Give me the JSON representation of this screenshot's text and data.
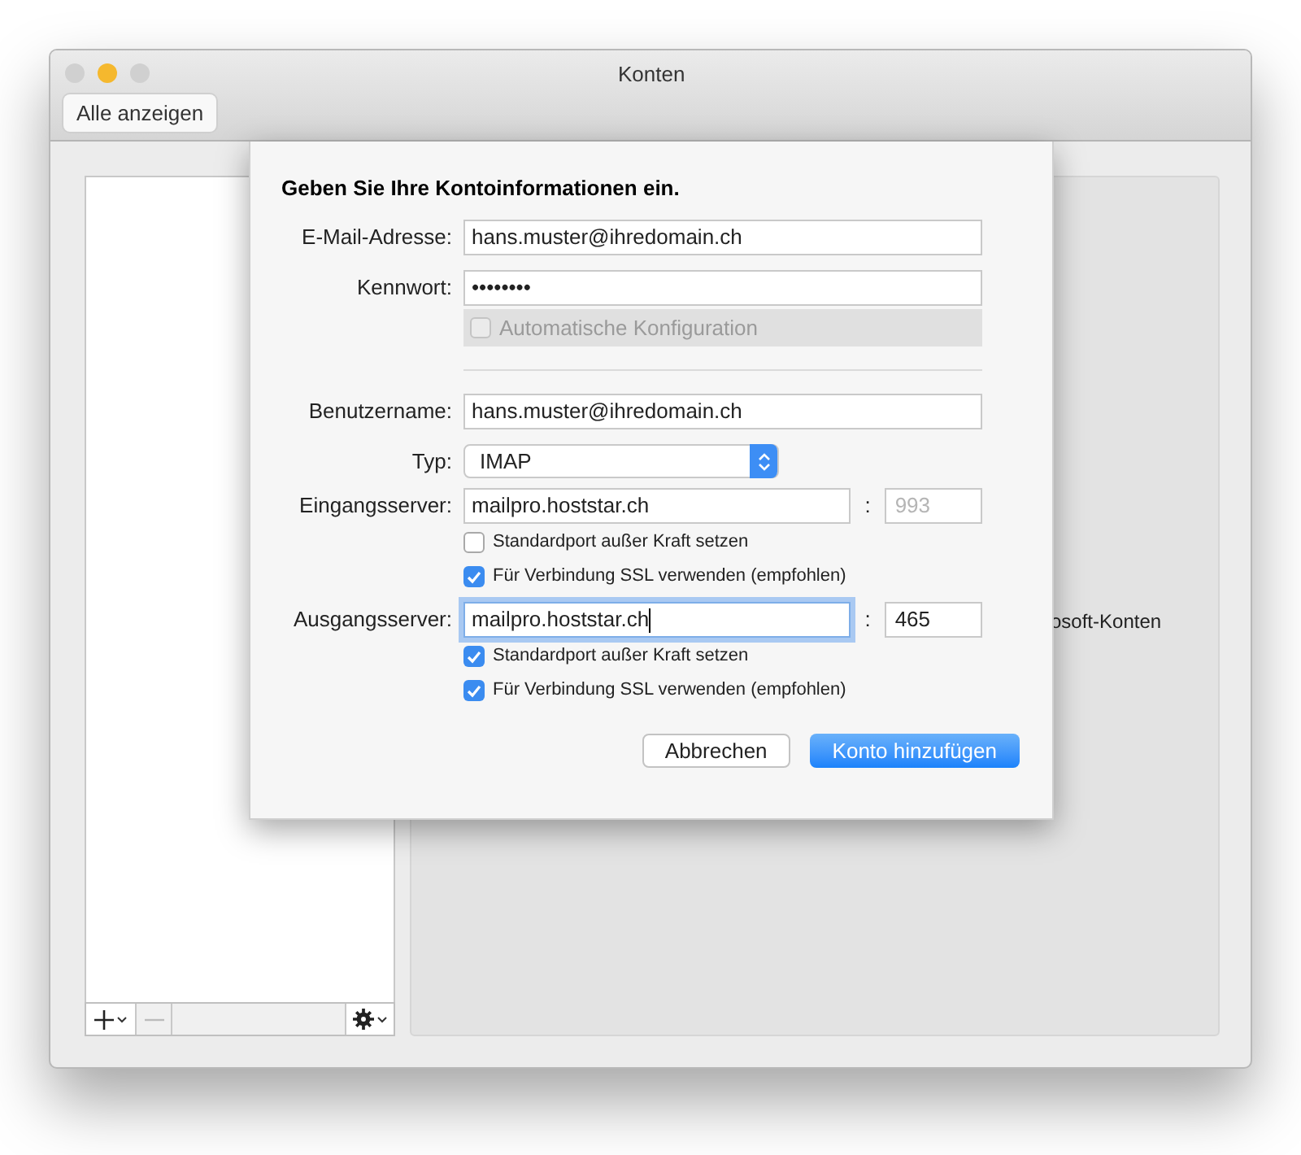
{
  "window": {
    "title": "Konten",
    "traffic_lights": [
      {
        "color": "#d0d0d0"
      },
      {
        "color": "#f5b82e"
      },
      {
        "color": "#d0d0d0"
      }
    ]
  },
  "toolbar": {
    "show_all_button": "Alle anzeigen"
  },
  "right_panel": {
    "text": "osoft-Konten"
  },
  "dialog": {
    "heading": "Geben Sie Ihre Kontoinformationen ein.",
    "rows": [
      {
        "kind": "field",
        "label": "E-Mail-Adresse:",
        "value": "hans.muster@ihredomain.ch",
        "focused": false
      },
      {
        "kind": "field",
        "label": "Kennwort:",
        "value": "••••••••",
        "focused": false
      },
      {
        "kind": "checkbox",
        "label": "Automatische Konfiguration",
        "checked": false,
        "disabled": true
      },
      {
        "kind": "divider"
      },
      {
        "kind": "field",
        "label": "Benutzername:",
        "value": "hans.muster@ihredomain.ch",
        "focused": false
      },
      {
        "kind": "select",
        "label": "Typ:",
        "value": "IMAP"
      },
      {
        "kind": "server",
        "label": "Eingangsserver:",
        "value": "mailpro.hoststar.ch",
        "focused": false,
        "port_separator": ":",
        "port": "993",
        "port_disabled": true
      },
      {
        "kind": "checkbox",
        "label": "Standardport außer Kraft setzen",
        "checked": false,
        "disabled": false
      },
      {
        "kind": "checkbox",
        "label": "Für Verbindung SSL verwenden (empfohlen)",
        "checked": true,
        "disabled": false
      },
      {
        "kind": "server",
        "label": "Ausgangsserver:",
        "value": "mailpro.hoststar.ch",
        "focused": true,
        "port_separator": ":",
        "port": "465",
        "port_disabled": false
      },
      {
        "kind": "checkbox",
        "label": "Standardport außer Kraft setzen",
        "checked": true,
        "disabled": false
      },
      {
        "kind": "checkbox",
        "label": "Für Verbindung SSL verwenden (empfohlen)",
        "checked": true,
        "disabled": false
      }
    ],
    "buttons": [
      {
        "label": "Abbrechen",
        "default": false
      },
      {
        "label": "Konto hinzufügen",
        "default": true
      }
    ]
  }
}
